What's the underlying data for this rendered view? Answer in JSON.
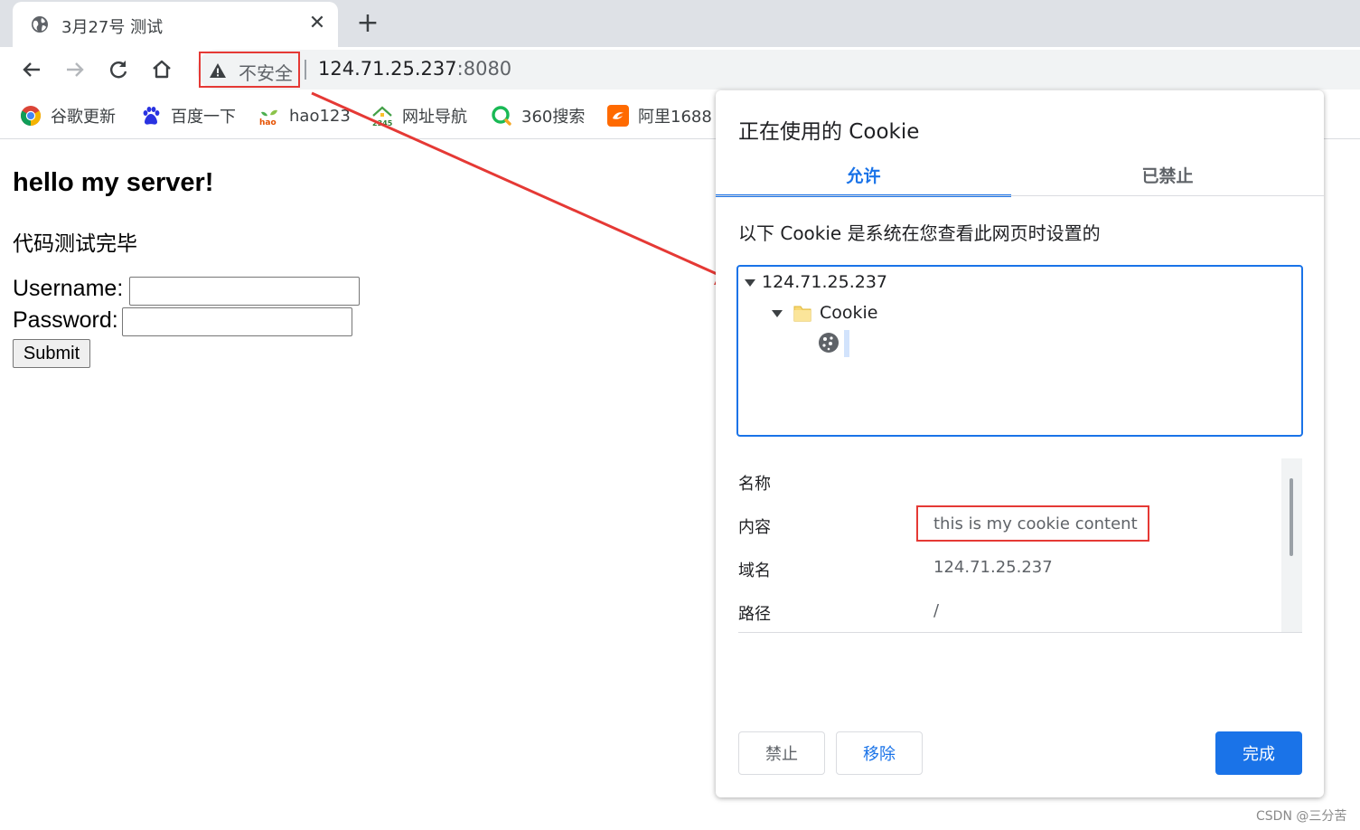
{
  "browser": {
    "tab": {
      "title": "3月27号 测试",
      "close_glyph": "✕"
    },
    "new_tab_glyph": "+",
    "omnibox": {
      "security_label": "不安全",
      "url_host": "124.71.25.237",
      "url_port": ":8080"
    },
    "bookmarks": [
      {
        "label": "谷歌更新",
        "icon": "chrome-icon"
      },
      {
        "label": "百度一下",
        "icon": "baidu-paw-icon"
      },
      {
        "label": "hao123",
        "icon": "hao123-icon"
      },
      {
        "label": "网址导航",
        "icon": "2345-house-icon"
      },
      {
        "label": "360搜索",
        "icon": "360-search-icon"
      },
      {
        "label": "阿里1688",
        "icon": "alibaba-1688-icon"
      }
    ]
  },
  "page": {
    "heading": "hello my server!",
    "text": "代码测试完毕",
    "username_label": "Username:",
    "password_label": "Password:",
    "submit_label": "Submit"
  },
  "dialog": {
    "title": "正在使用的 Cookie",
    "tabs": [
      "允许",
      "已禁止"
    ],
    "description": "以下 Cookie 是系统在您查看此网页时设置的",
    "tree": {
      "host": "124.71.25.237",
      "folder": "Cookie"
    },
    "details": [
      {
        "label": "名称",
        "value": ""
      },
      {
        "label": "内容",
        "value": "this is my cookie content"
      },
      {
        "label": "域名",
        "value": "124.71.25.237"
      },
      {
        "label": "路径",
        "value": "/"
      }
    ],
    "buttons": {
      "block": "禁止",
      "remove": "移除",
      "done": "完成"
    }
  },
  "watermark": "CSDN @三分苦",
  "colors": {
    "accent": "#1a73e8",
    "annotation_red": "#e53935",
    "tabstrip": "#dee1e6",
    "omnibox": "#f1f3f4"
  }
}
